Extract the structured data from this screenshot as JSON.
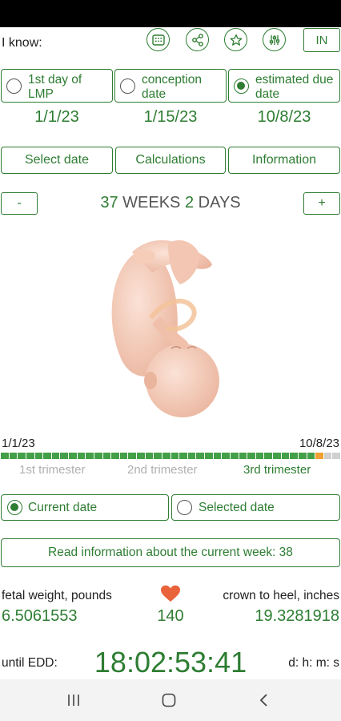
{
  "header": {
    "i_know": "I know:",
    "unit": "IN",
    "icons": [
      "calendar-grid-icon",
      "share-icon",
      "star-icon",
      "sliders-icon"
    ]
  },
  "modes": [
    {
      "label": "1st day of LMP",
      "date": "1/1/23",
      "selected": false
    },
    {
      "label": "conception date",
      "date": "1/15/23",
      "selected": false
    },
    {
      "label": "estimated due date",
      "date": "10/8/23",
      "selected": true
    }
  ],
  "actions": {
    "select_date": "Select date",
    "calculations": "Calculations",
    "information": "Information"
  },
  "stepper": {
    "minus": "-",
    "plus": "+",
    "weeks_num": "37",
    "weeks_word": "WEEKS",
    "days_num": "2",
    "days_word": "DAYS"
  },
  "progress": {
    "start": "1/1/23",
    "end": "10/8/23",
    "current_fraction": 0.942,
    "trimesters": [
      "1st trimester",
      "2nd trimester",
      "3rd trimester"
    ],
    "active_trimester": 2
  },
  "date_modes": {
    "current": "Current date",
    "selected": "Selected date",
    "current_selected": true
  },
  "info_button": "Read information about the current week: 38",
  "stats": {
    "weight_label": "fetal weight, pounds",
    "weight_value": "6.5061553",
    "heart_rate": "140",
    "length_label": "crown to heel, inches",
    "length_value": "19.3281918"
  },
  "edd": {
    "label": "until EDD:",
    "time": "18:02:53:41",
    "units": "d: h: m: s"
  },
  "colors": {
    "accent": "#2e7d32",
    "progress_done": "#43a047",
    "progress_current": "#f0a030",
    "progress_remaining": "#d0d0d0",
    "heart": "#e8623a"
  }
}
